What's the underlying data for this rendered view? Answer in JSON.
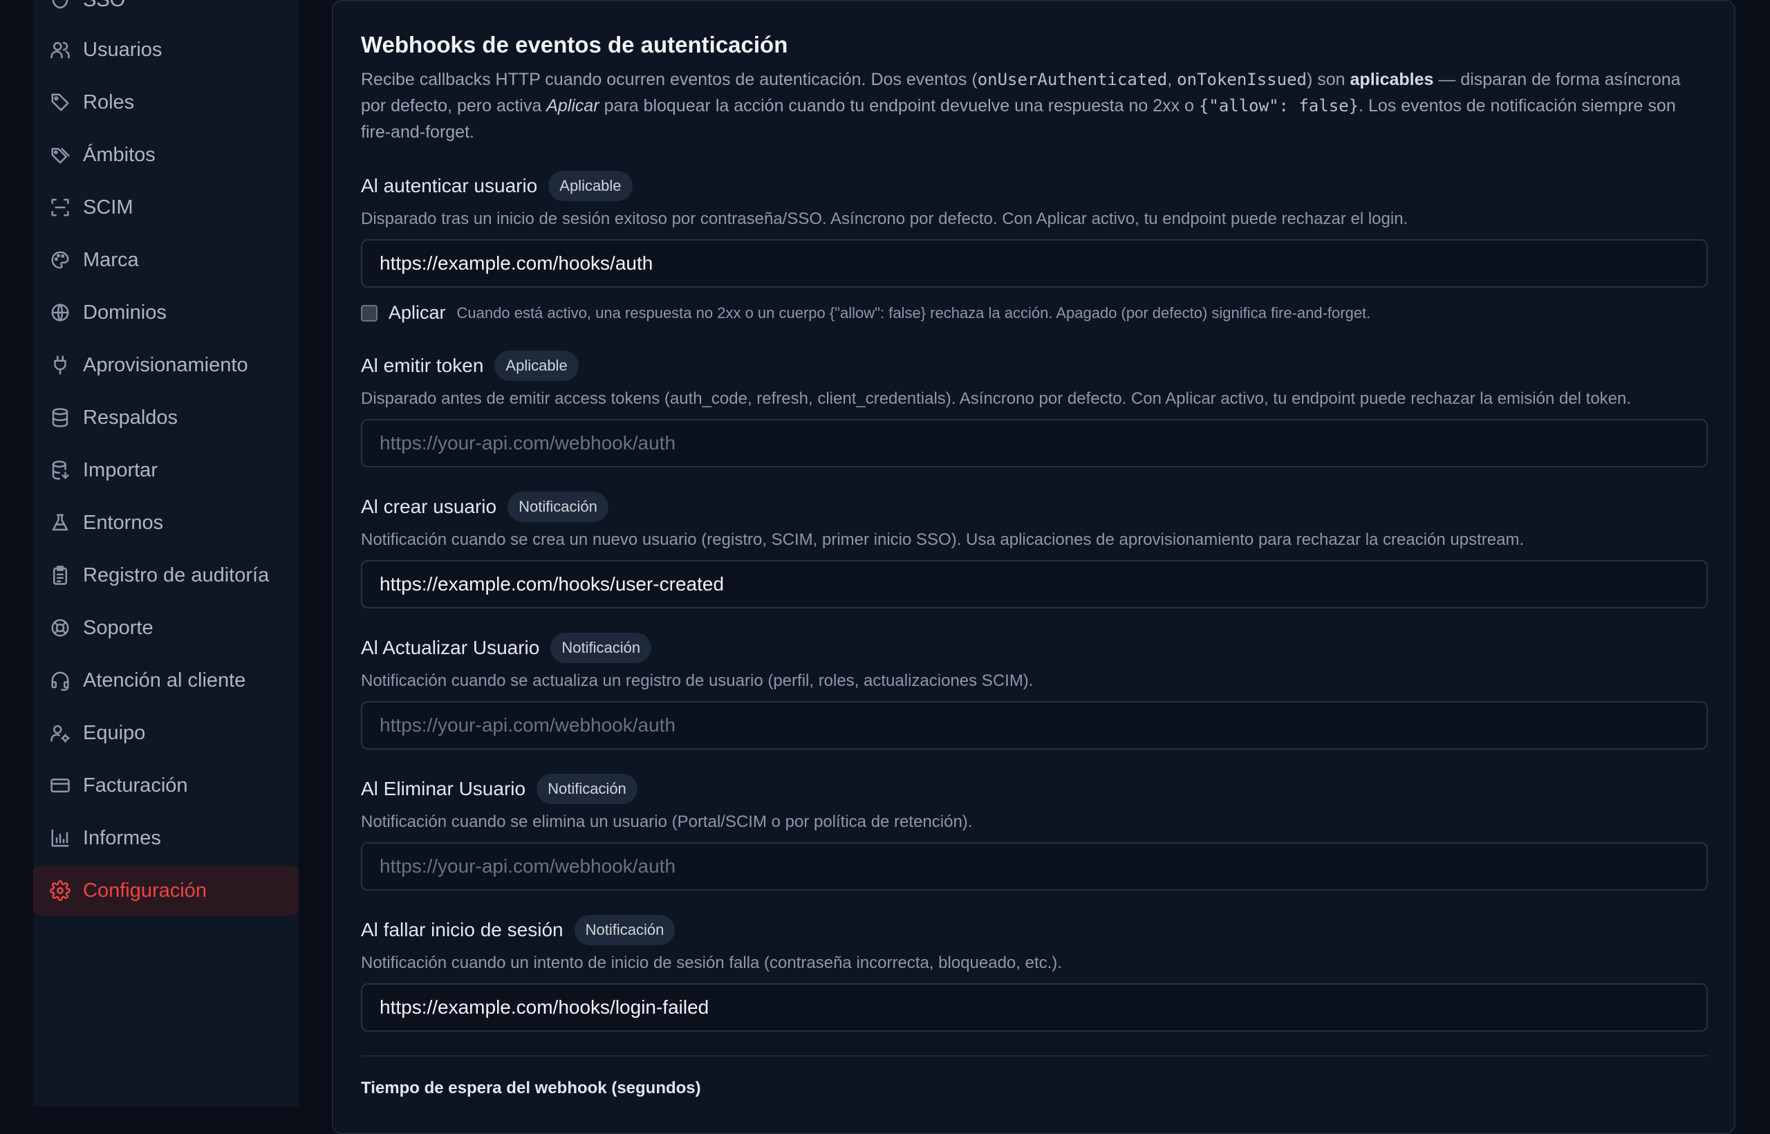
{
  "sidebar": {
    "items": [
      {
        "label": "SSO",
        "icon": "shield-icon"
      },
      {
        "label": "Usuarios",
        "icon": "users-icon"
      },
      {
        "label": "Roles",
        "icon": "tag-icon"
      },
      {
        "label": "Ámbitos",
        "icon": "tags-icon"
      },
      {
        "label": "SCIM",
        "icon": "scan-icon"
      },
      {
        "label": "Marca",
        "icon": "palette-icon"
      },
      {
        "label": "Dominios",
        "icon": "globe-icon"
      },
      {
        "label": "Aprovisionamiento",
        "icon": "plug-icon"
      },
      {
        "label": "Respaldos",
        "icon": "database-icon"
      },
      {
        "label": "Importar",
        "icon": "database-import-icon"
      },
      {
        "label": "Entornos",
        "icon": "flask-icon"
      },
      {
        "label": "Registro de auditoría",
        "icon": "clipboard-icon"
      },
      {
        "label": "Soporte",
        "icon": "lifebuoy-icon"
      },
      {
        "label": "Atención al cliente",
        "icon": "headset-icon"
      },
      {
        "label": "Equipo",
        "icon": "user-cog-icon"
      },
      {
        "label": "Facturación",
        "icon": "credit-card-icon"
      },
      {
        "label": "Informes",
        "icon": "bar-chart-icon"
      },
      {
        "label": "Configuración",
        "icon": "gear-icon",
        "active": true
      }
    ],
    "accent_color": "#ef4444"
  },
  "webhooks": {
    "title": "Webhooks de eventos de autenticación",
    "intro": {
      "p1": "Recibe callbacks HTTP cuando ocurren eventos de autenticación. Dos eventos (",
      "code1": "onUserAuthenticated",
      "p2": ", ",
      "code2": "onTokenIssued",
      "p3": ") son ",
      "bold": "aplicables",
      "p4": " — disparan de forma asíncrona por defecto, pero activa ",
      "italic": "Aplicar",
      "p5": " para bloquear la acción cuando tu endpoint devuelve una respuesta no 2xx o ",
      "code3": "{\"allow\": false}",
      "p6": ". Los eventos de notificación siempre son fire-and-forget."
    },
    "placeholder": "https://your-api.com/webhook/auth",
    "sections": [
      {
        "title": "Al autenticar usuario",
        "badge": "Aplicable",
        "desc": "Disparado tras un inicio de sesión exitoso por contraseña/SSO. Asíncrono por defecto. Con Aplicar activo, tu endpoint puede rechazar el login.",
        "value": "https://example.com/hooks/auth",
        "enforce_label": "Aplicar",
        "enforce_help": "Cuando está activo, una respuesta no 2xx o un cuerpo {\"allow\": false} rechaza la acción. Apagado (por defecto) significa fire-and-forget.",
        "enforce_checked": false
      },
      {
        "title": "Al emitir token",
        "badge": "Aplicable",
        "desc": "Disparado antes de emitir access tokens (auth_code, refresh, client_credentials). Asíncrono por defecto. Con Aplicar activo, tu endpoint puede rechazar la emisión del token.",
        "value": ""
      },
      {
        "title": "Al crear usuario",
        "badge": "Notificación",
        "desc": "Notificación cuando se crea un nuevo usuario (registro, SCIM, primer inicio SSO). Usa aplicaciones de aprovisionamiento para rechazar la creación upstream.",
        "value": "https://example.com/hooks/user-created"
      },
      {
        "title": "Al Actualizar Usuario",
        "badge": "Notificación",
        "desc": "Notificación cuando se actualiza un registro de usuario (perfil, roles, actualizaciones SCIM).",
        "value": ""
      },
      {
        "title": "Al Eliminar Usuario",
        "badge": "Notificación",
        "desc": "Notificación cuando se elimina un usuario (Portal/SCIM o por política de retención).",
        "value": ""
      },
      {
        "title": "Al fallar inicio de sesión",
        "badge": "Notificación",
        "desc": "Notificación cuando un intento de inicio de sesión falla (contraseña incorrecta, bloqueado, etc.).",
        "value": "https://example.com/hooks/login-failed"
      }
    ],
    "timeout_label": "Tiempo de espera del webhook (segundos)"
  }
}
